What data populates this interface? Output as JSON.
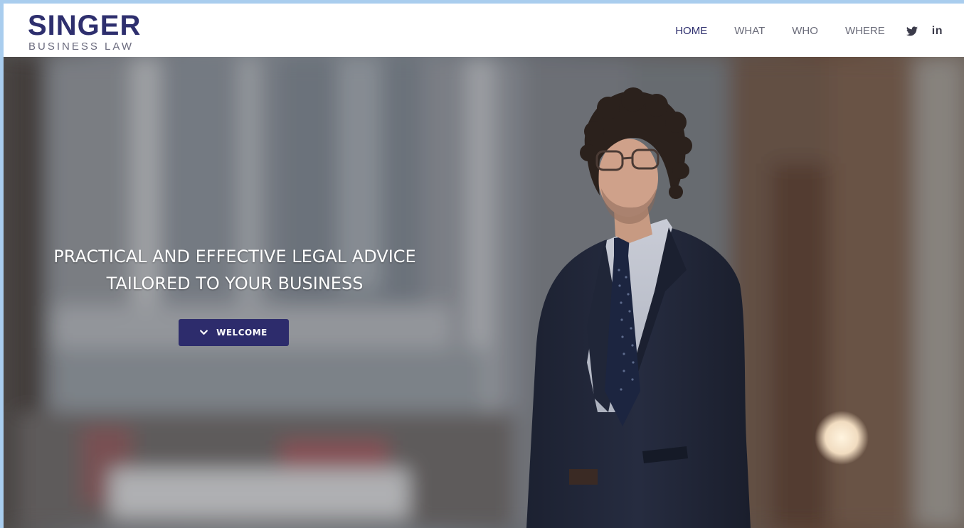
{
  "brand": {
    "name": "SINGER",
    "tagline": "BUSINESS LAW",
    "color": "#2e2f6e"
  },
  "nav": {
    "items": [
      {
        "label": "HOME",
        "active": true
      },
      {
        "label": "WHAT",
        "active": false
      },
      {
        "label": "WHO",
        "active": false
      },
      {
        "label": "WHERE",
        "active": false
      }
    ],
    "social": [
      {
        "icon": "twitter-icon"
      },
      {
        "icon": "linkedin-icon",
        "glyph": "in"
      }
    ]
  },
  "hero": {
    "line1": "PRACTICAL AND EFFECTIVE LEGAL ADVICE",
    "line2": "TAILORED TO YOUR BUSINESS",
    "button_label": "WELCOME",
    "button_icon": "chevron-down-icon",
    "button_color": "#2d2c6c",
    "image": "lawyer-portrait-photo"
  },
  "colors": {
    "frame": "#a9cdee",
    "nav_text": "#6b6c7a",
    "nav_active": "#2e2f6e"
  }
}
